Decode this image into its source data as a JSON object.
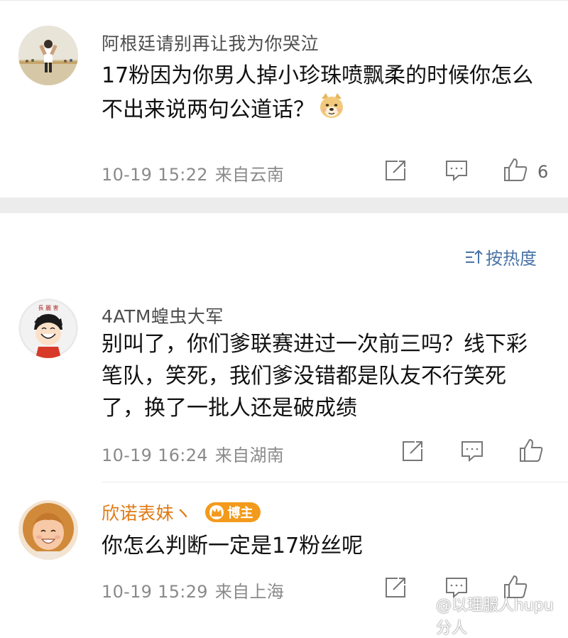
{
  "comments": [
    {
      "username": "阿根廷请别再让我为你哭泣",
      "text": "17粉因为你男人掉小珍珠喷飘柔的时候你怎么不出来说两句公道话？",
      "time": "10-19 15:22",
      "location": "来自云南",
      "likes": "6",
      "emoji": "doge-emoji"
    },
    {
      "username": "4ATM蝗虫大军",
      "text": "别叫了，你们爹联赛进过一次前三吗？线下彩笔队，笑死，我们爹没错都是队友不行笑死了，换了一批人还是破成绩",
      "time": "10-19 16:24",
      "location": "来自湖南"
    },
    {
      "username": "欣诺表妹ヽ",
      "badge": "博主",
      "text": "你怎么判断一定是17粉丝呢",
      "time": "10-19 15:29",
      "location": "来自上海"
    }
  ],
  "sort_label": "按热度",
  "watermark_text": "@以理服人hupu分人",
  "colors": {
    "vip_name": "#e07a14",
    "badge_bg": "#f39a1c",
    "sort_link": "#4a74a6",
    "meta": "#8a8a8a",
    "separator": "#ececec"
  },
  "icons": [
    "repost-icon",
    "comment-icon",
    "like-icon",
    "sort-icon",
    "crown-icon"
  ]
}
